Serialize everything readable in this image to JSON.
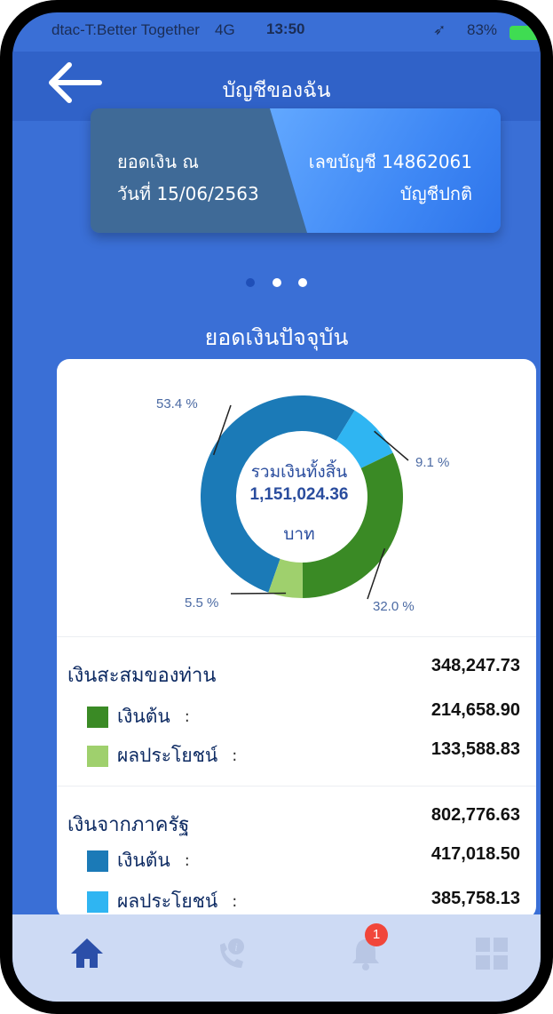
{
  "status": {
    "carrier": "dtac-T:Better Together",
    "network": "4G",
    "time": "13:50",
    "battery": "83%"
  },
  "header": {
    "title": "บัญชีของฉัน"
  },
  "card": {
    "balance_line1": "ยอดเงิน ณ",
    "balance_line2": "วันที่ 15/06/2563",
    "account_line1": "เลขบัญชี 14862061",
    "account_line2": "บัญชีปกติ"
  },
  "section": {
    "title": "ยอดเงินปัจจุบัน"
  },
  "chart_data": {
    "type": "pie",
    "center_label": "รวมเงินทั้งสิ้น",
    "center_value": "1,151,024.36",
    "center_unit": "บาท",
    "slices": [
      {
        "label": "53.4 %",
        "value": 53.4,
        "color": "#1b7ab7"
      },
      {
        "label": "9.1 %",
        "value": 9.1,
        "color": "#2fb5f2"
      },
      {
        "label": "32.0 %",
        "value": 32.0,
        "color": "#3a8a25"
      },
      {
        "label": "5.5 %",
        "value": 5.5,
        "color": "#9fd06d"
      }
    ]
  },
  "savings": {
    "label": "เงินสะสมของท่าน",
    "total": "348,247.73",
    "items": [
      {
        "label": "เงินต้น",
        "colon": ":",
        "value": "214,658.90",
        "color": "#3a8a25"
      },
      {
        "label": "ผลประโยชน์",
        "colon": ":",
        "value": "133,588.83",
        "color": "#9fd06d"
      }
    ]
  },
  "government": {
    "label": "เงินจากภาครัฐ",
    "total": "802,776.63",
    "items": [
      {
        "label": "เงินต้น",
        "colon": ":",
        "value": "417,018.50",
        "color": "#1b7ab7"
      },
      {
        "label": "ผลประโยชน์",
        "colon": ":",
        "value": "385,758.13",
        "color": "#2fb5f2"
      }
    ]
  },
  "tabbar": {
    "items": [
      {
        "icon": "home-icon"
      },
      {
        "icon": "phone-info-icon"
      },
      {
        "icon": "bell-icon",
        "badge": "1"
      },
      {
        "icon": "grid-icon"
      }
    ]
  }
}
